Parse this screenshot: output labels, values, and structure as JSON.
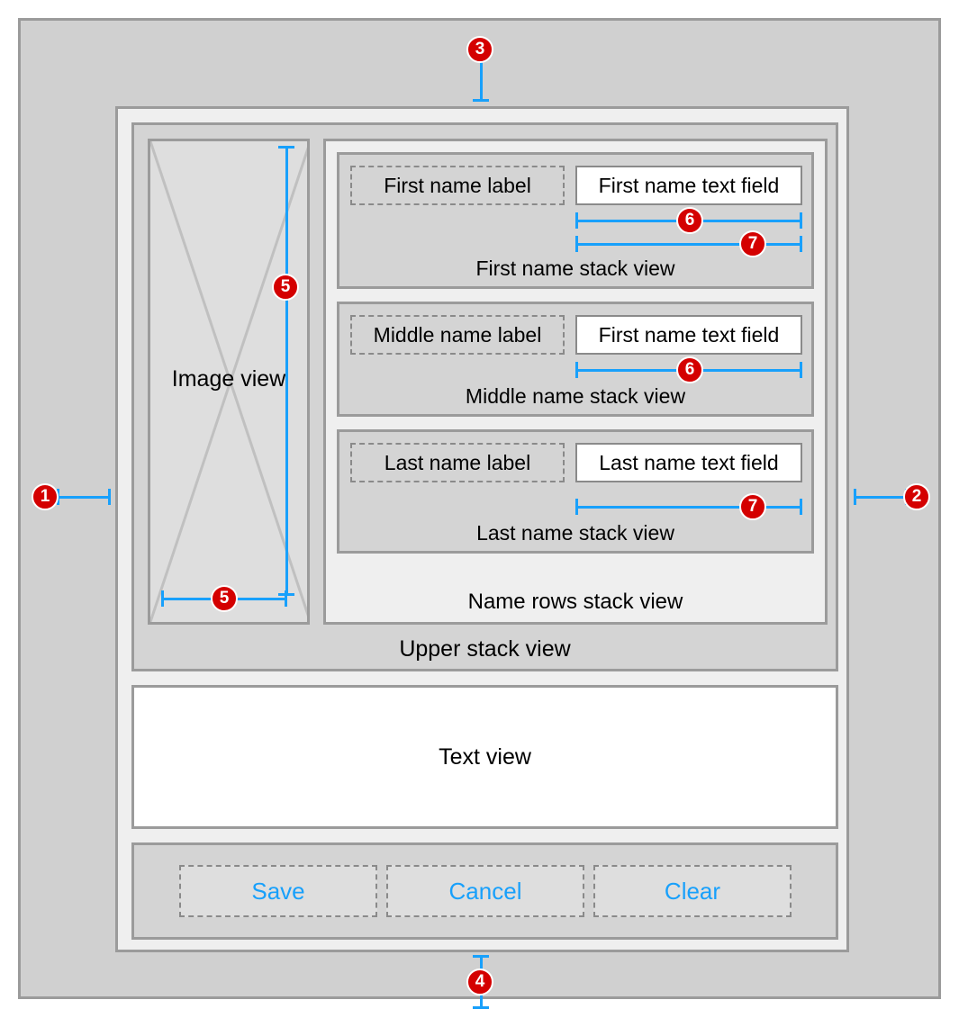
{
  "markers": {
    "m1": "1",
    "m2": "2",
    "m3": "3",
    "m4": "4",
    "m5": "5",
    "m6": "6",
    "m7": "7"
  },
  "upper_stack": {
    "caption": "Upper stack view"
  },
  "image_view": {
    "label": "Image view"
  },
  "name_rows": {
    "caption": "Name rows stack view",
    "rows": [
      {
        "label": "First name label",
        "field": "First name text field",
        "caption": "First name stack view"
      },
      {
        "label": "Middle name label",
        "field": "First name text field",
        "caption": "Middle name stack view"
      },
      {
        "label": "Last name label",
        "field": "Last name text field",
        "caption": "Last name stack view"
      }
    ]
  },
  "text_view": {
    "label": "Text view"
  },
  "buttons": {
    "save": "Save",
    "cancel": "Cancel",
    "clear": "Clear"
  }
}
